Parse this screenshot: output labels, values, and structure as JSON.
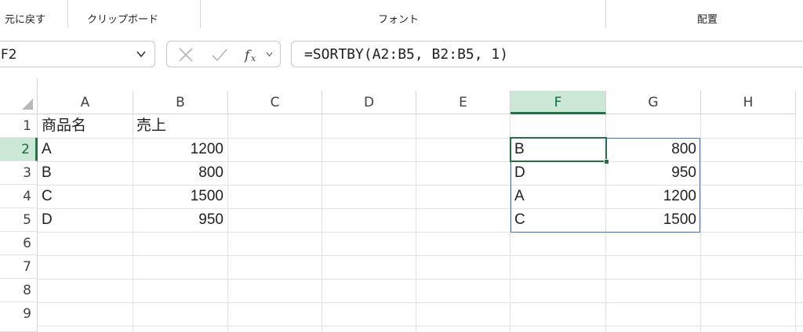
{
  "ribbon": {
    "groups": [
      {
        "label": "元に戻す"
      },
      {
        "label": "クリップボード"
      },
      {
        "label": "フォント"
      },
      {
        "label": "配置"
      }
    ]
  },
  "formula_bar": {
    "name_box": "F2",
    "cancel_icon": "x-icon",
    "enter_icon": "check-icon",
    "function_icon": "fx-icon",
    "formula": "=SORTBY(A2:B5, B2:B5, 1)"
  },
  "sheet": {
    "columns": [
      "A",
      "B",
      "C",
      "D",
      "E",
      "F",
      "G",
      "H"
    ],
    "rows": [
      "1",
      "2",
      "3",
      "4",
      "5",
      "6",
      "7",
      "8",
      "9"
    ],
    "selected_column": "F",
    "selected_row": "2",
    "cells": {
      "A1": "商品名",
      "B1": "売上",
      "A2": "A",
      "B2": "1200",
      "A3": "B",
      "B3": "800",
      "A4": "C",
      "B4": "1500",
      "A5": "D",
      "B5": "950",
      "F2": "B",
      "G2": "800",
      "F3": "D",
      "G3": "950",
      "F4": "A",
      "G4": "1200",
      "F5": "C",
      "G5": "1500"
    }
  },
  "colors": {
    "selection_green": "#217346",
    "header_highlight": "#cbe8d6",
    "spill_border": "#3f6fc4"
  }
}
